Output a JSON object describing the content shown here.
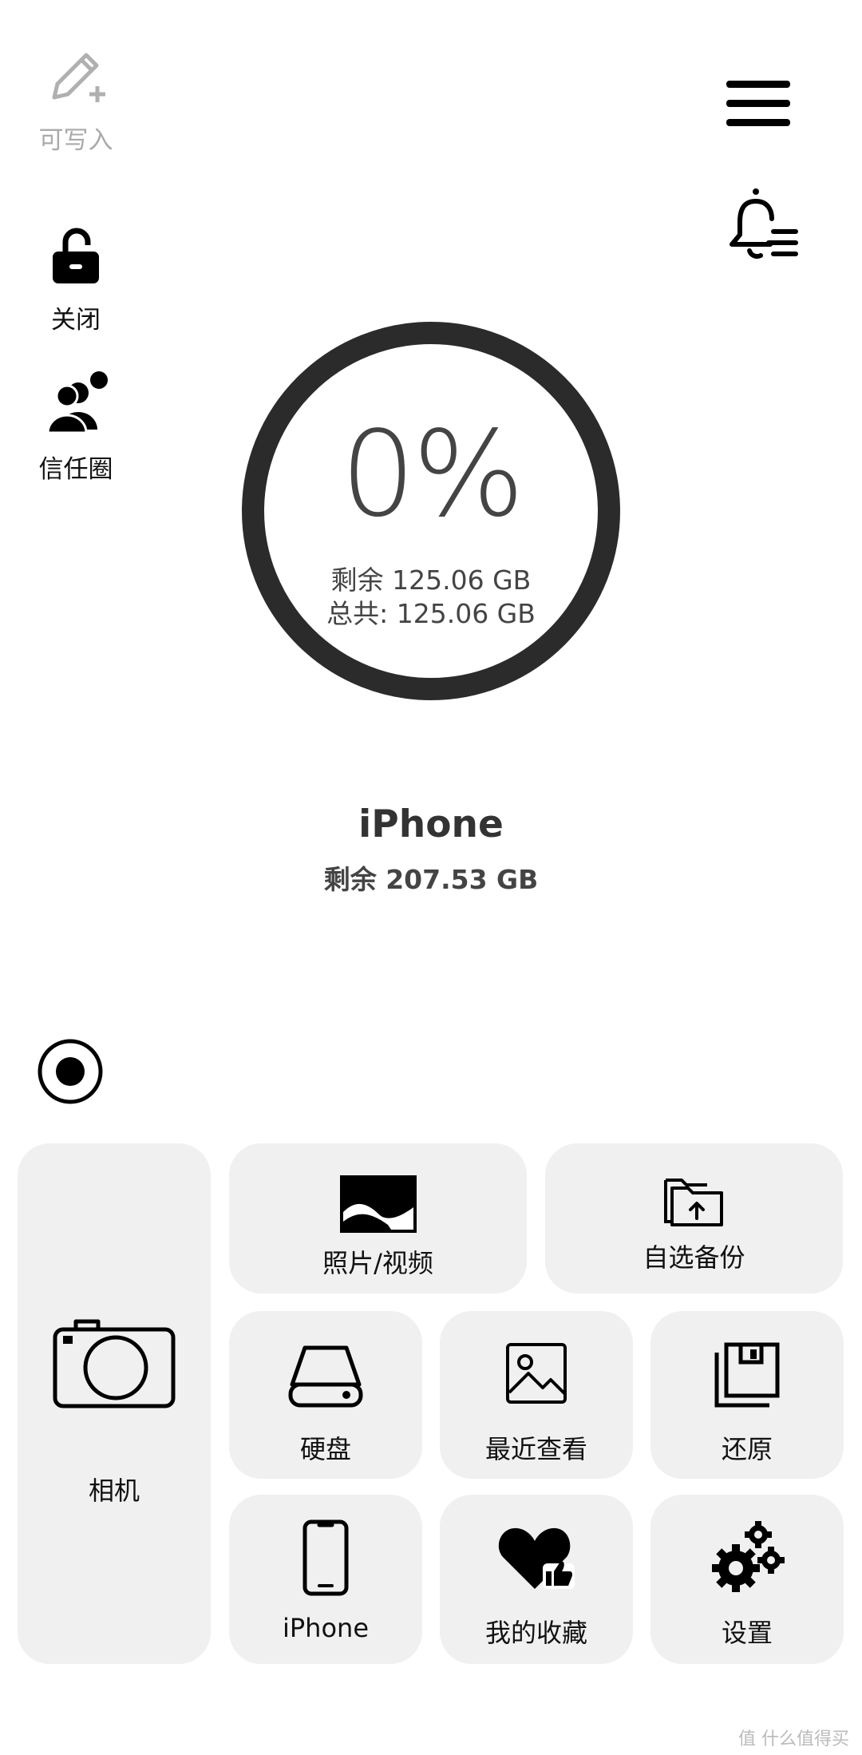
{
  "sidebar": {
    "write": {
      "label": "可写入",
      "icon": "pencil-plus-icon"
    },
    "lock": {
      "label": "关闭",
      "icon": "unlock-icon"
    },
    "trust": {
      "label": "信任圈",
      "icon": "users-icon"
    }
  },
  "header": {
    "menu_icon": "hamburger-menu-icon",
    "bell_icon": "bell-list-icon"
  },
  "storage": {
    "percent": "0%",
    "used_fraction": 0,
    "remaining": "剩余 125.06 GB",
    "total": "总共: 125.06 GB"
  },
  "device": {
    "name": "iPhone",
    "remaining": "剩余 207.53 GB"
  },
  "record_icon": "record-icon",
  "tiles": {
    "camera": "相机",
    "photos": "照片/视频",
    "backup": "自选备份",
    "disk": "硬盘",
    "recent": "最近查看",
    "restore": "还原",
    "iphone": "iPhone",
    "favorites": "我的收藏",
    "settings": "设置"
  },
  "watermark": "值 什么值得买"
}
